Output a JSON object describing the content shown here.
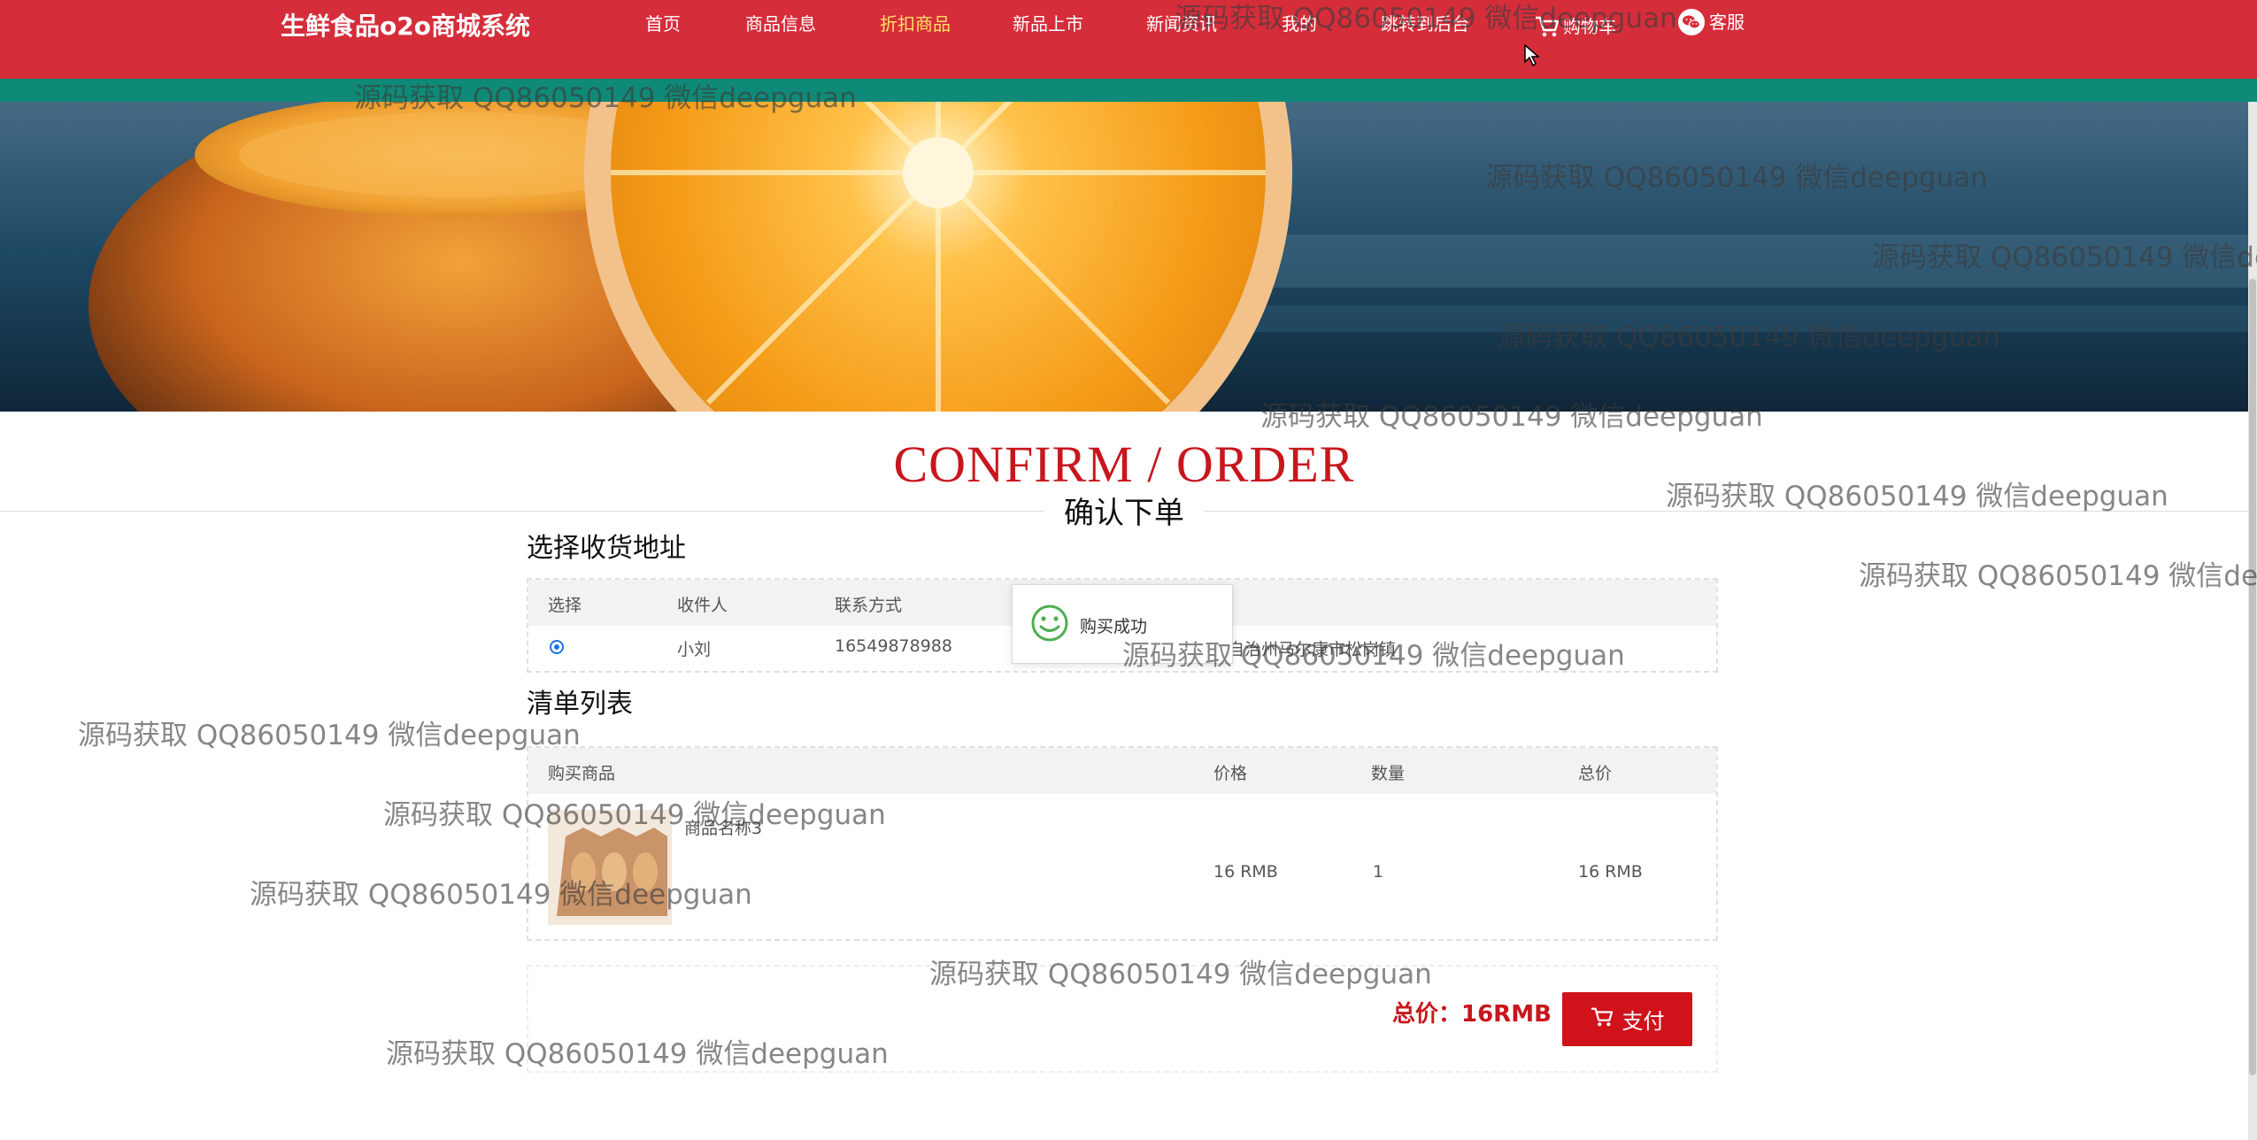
{
  "header": {
    "brand": "生鲜食品o2o商城系统",
    "nav": [
      {
        "label": "首页"
      },
      {
        "label": "商品信息"
      },
      {
        "label": "折扣商品"
      },
      {
        "label": "新品上市"
      },
      {
        "label": "新闻资讯"
      },
      {
        "label": "我的"
      },
      {
        "label": "跳转到后台"
      },
      {
        "label": "购物车"
      },
      {
        "label": "客服"
      }
    ],
    "active_index": 2
  },
  "page": {
    "title": "CONFIRM / ORDER",
    "subtitle": "确认下单"
  },
  "address_section": {
    "title": "选择收货地址",
    "headers": [
      "选择",
      "收件人",
      "联系方式"
    ],
    "rows": [
      {
        "selected": true,
        "recipient": "小刘",
        "phone": "16549878988",
        "address_partial": "自治州马尔康市松岗镇"
      }
    ]
  },
  "list_section": {
    "title": "清单列表",
    "headers": [
      "购买商品",
      "价格",
      "数量",
      "总价"
    ],
    "items": [
      {
        "name": "商品名称3",
        "price": "16 RMB",
        "quantity": "1",
        "total": "16 RMB"
      }
    ]
  },
  "summary": {
    "total_label": "总价：16RMB",
    "pay_label": "支付"
  },
  "toast": {
    "text": "购买成功"
  },
  "watermark": {
    "text": "源码获取 QQ86050149 微信deepguan",
    "text_cut": "源码获取 QQ86050149 微信dee"
  },
  "colors": {
    "nav_bg": "#d62d3b",
    "strip": "#0f8a78",
    "accent_red": "#c8161d",
    "active_nav": "#ffe066"
  }
}
